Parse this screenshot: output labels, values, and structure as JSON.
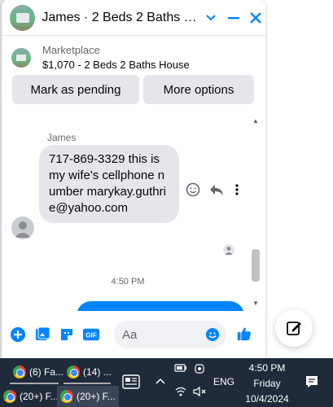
{
  "chat": {
    "title": "James · 2 Beds 2 Baths House",
    "listing": {
      "kind": "Marketplace",
      "name": "$1,070 - 2 Beds 2 Baths House"
    },
    "actions": {
      "mark_pending": "Mark as pending",
      "more_options": "More options"
    },
    "messages": {
      "sender_name": "James",
      "text": "717-869-3329 this is my wife's cellphone number marykay.guthrie@yahoo.com",
      "timestamp": "4:50 PM"
    },
    "composer": {
      "placeholder": "Aa"
    }
  },
  "taskbar": {
    "apps": [
      {
        "label": "(6) Fa..."
      },
      {
        "label": "(14) ..."
      },
      {
        "label": "(20+) F..."
      },
      {
        "label": "(20+) F..."
      }
    ],
    "language": "ENG",
    "time": "4:50 PM",
    "day": "Friday",
    "date": "10/4/2024"
  },
  "colors": {
    "accent": "#0084ff",
    "bubble_incoming": "#e4e6eb",
    "taskbar": "#1f2a3a"
  }
}
